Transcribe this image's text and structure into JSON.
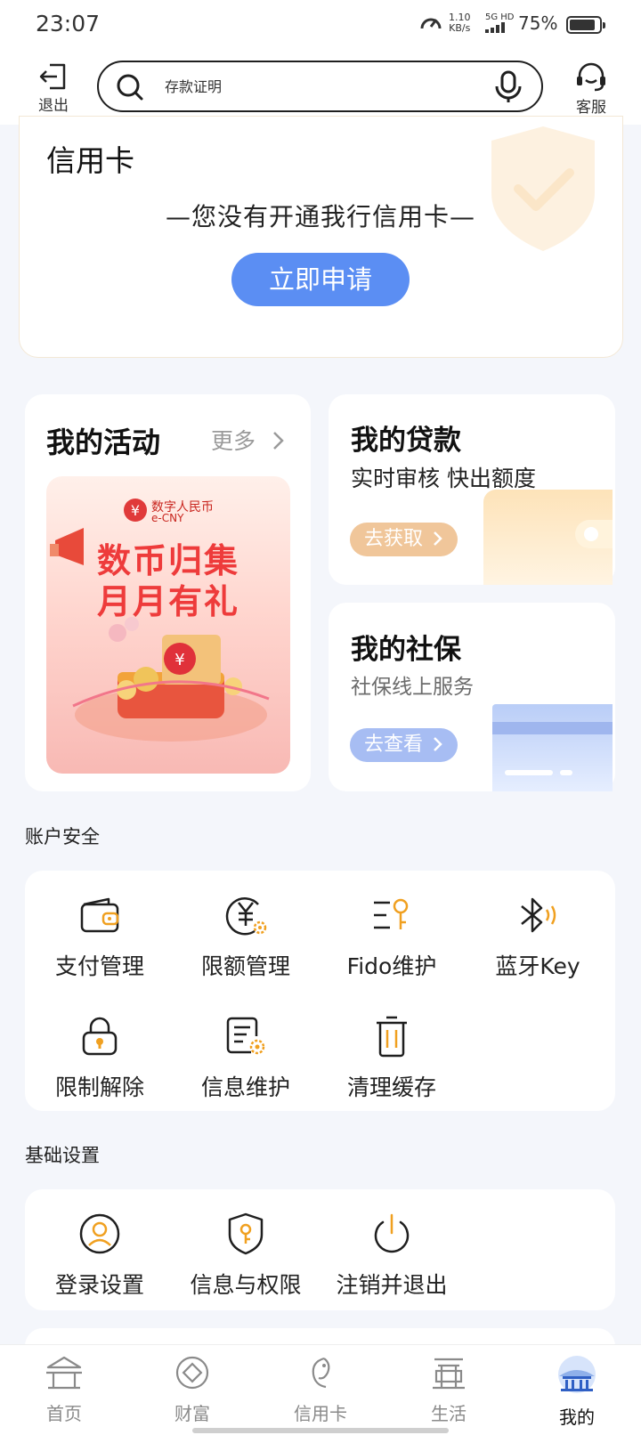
{
  "status_bar": {
    "time": "23:07",
    "speed_value": "1.10",
    "speed_unit": "KB/s",
    "network": "5G HD",
    "battery": "75%"
  },
  "header": {
    "exit_label": "退出",
    "search_placeholder": "存款证明",
    "service_label": "客服"
  },
  "credit_card": {
    "title": "信用卡",
    "empty_text": "—您没有开通我行信用卡—",
    "apply_label": "立即申请"
  },
  "activities": {
    "title": "我的活动",
    "more_label": "更多",
    "banner": {
      "brand_cn": "数字人民币",
      "brand_en": "e-CNY",
      "line1": "数币归集",
      "line2": "月月有礼"
    }
  },
  "loan": {
    "title": "我的贷款",
    "subtitle": "实时审核 快出额度",
    "button_label": "去获取"
  },
  "social_insurance": {
    "title": "我的社保",
    "subtitle": "社保线上服务",
    "button_label": "去查看"
  },
  "account_security": {
    "section_label": "账户安全",
    "items": [
      {
        "label": "支付管理",
        "icon": "wallet-icon"
      },
      {
        "label": "限额管理",
        "icon": "yuan-limit-icon"
      },
      {
        "label": "Fido维护",
        "icon": "fido-icon"
      },
      {
        "label": "蓝牙Key",
        "icon": "bluetooth-icon"
      },
      {
        "label": "限制解除",
        "icon": "unlock-icon"
      },
      {
        "label": "信息维护",
        "icon": "document-gear-icon"
      },
      {
        "label": "清理缓存",
        "icon": "trash-icon"
      }
    ]
  },
  "basic_settings": {
    "section_label": "基础设置",
    "items": [
      {
        "label": "登录设置",
        "icon": "user-circle-icon"
      },
      {
        "label": "信息与权限",
        "icon": "shield-key-icon"
      },
      {
        "label": "注销并退出",
        "icon": "power-icon"
      }
    ]
  },
  "bottom_nav": {
    "items": [
      {
        "label": "首页",
        "icon": "home-icon",
        "active": false
      },
      {
        "label": "财富",
        "icon": "wealth-icon",
        "active": false
      },
      {
        "label": "信用卡",
        "icon": "credit-card-icon",
        "active": false
      },
      {
        "label": "生活",
        "icon": "life-icon",
        "active": false
      },
      {
        "label": "我的",
        "icon": "mine-icon",
        "active": true
      }
    ]
  },
  "colors": {
    "accent_orange": "#f0a020",
    "apply_blue": "#5b8ef3",
    "loan_button": "#f0c69a",
    "social_button": "#a7bdf3",
    "page_background": "#f4f6fb"
  }
}
